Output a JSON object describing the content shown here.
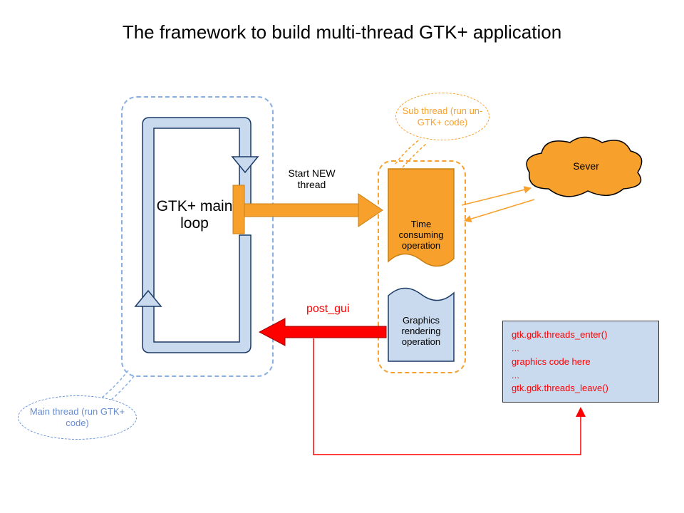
{
  "title": "The framework to build multi-thread GTK+ application",
  "mainLoopLabel": "GTK+ main loop",
  "startThreadLabel": "Start NEW thread",
  "postGuiLabel": "post_gui",
  "subThread": {
    "timeBox": "Time consuming operation",
    "graphicsBox": "Graphics rendering operation"
  },
  "bubbles": {
    "main": "Main thread (run GTK+ code)",
    "sub": "Sub thread (run un-GTK+ code)"
  },
  "cloudLabel": "Sever",
  "code": {
    "l1": "gtk.gdk.threads_enter()",
    "l2": "...",
    "l3": "graphics code here",
    "l4": "...",
    "l5": "gtk.gdk.threads_leave()"
  },
  "colors": {
    "blueFill": "#c9daef",
    "blueStroke": "#1b3b67",
    "orangeFill": "#f8a02c",
    "orangeStroke": "#c87f15",
    "red": "#ff0000"
  }
}
